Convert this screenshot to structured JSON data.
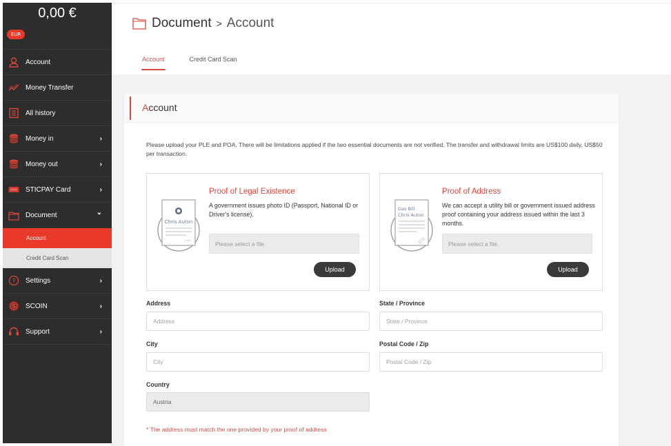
{
  "sidebar": {
    "balance": "0,00 €",
    "currency": "EUR",
    "items": [
      {
        "label": "Account",
        "icon": "user-icon",
        "has_chevron": false
      },
      {
        "label": "Money Transfer",
        "icon": "transfer-icon",
        "has_chevron": false
      },
      {
        "label": "All history",
        "icon": "history-icon",
        "has_chevron": false
      },
      {
        "label": "Money in",
        "icon": "money-in-icon",
        "has_chevron": true
      },
      {
        "label": "Money out",
        "icon": "money-out-icon",
        "has_chevron": true
      },
      {
        "label": "STICPAY Card",
        "icon": "card-icon",
        "has_chevron": true
      },
      {
        "label": "Document",
        "icon": "folder-icon",
        "has_chevron": true,
        "expanded": true
      },
      {
        "label": "Settings",
        "icon": "settings-icon",
        "has_chevron": true
      },
      {
        "label": "SCOIN",
        "icon": "scoin-icon",
        "has_chevron": true
      },
      {
        "label": "Support",
        "icon": "headset-icon",
        "has_chevron": true
      }
    ],
    "document_subitems": [
      {
        "label": "Account",
        "active": true
      },
      {
        "label": "Credit Card Scan",
        "active": false
      }
    ],
    "chevron_right": "›",
    "chevron_down": "⌄"
  },
  "header": {
    "breadcrumb": [
      "Document",
      "Account"
    ],
    "separator": ">",
    "tabs": [
      {
        "label": "Account",
        "active": true
      },
      {
        "label": "Credit Card Scan",
        "active": false
      }
    ]
  },
  "card": {
    "title_first": "A",
    "title_rest": "ccount",
    "intro": "Please upload your PLE and POA. There will be limitations applied if the two essential documents are not verified. The transfer and withdrawal limits are US$100 daily, US$50 per transaction.",
    "ple": {
      "title": "Proof of Legal Existence",
      "description": "A government issues photo ID (Passport, National ID or Driver's license).",
      "illustration_name": "Chris Auton",
      "file_placeholder": "Please select a file.",
      "upload_label": "Upload"
    },
    "poa": {
      "title": "Proof of Address",
      "description": "We can accept a utility bill or government issued address proof containing your address issued within the last 3 months.",
      "illustration_line1": "Gas Bill",
      "illustration_line2": "Chris Auton",
      "file_placeholder": "Please select a file.",
      "upload_label": "Upload"
    },
    "fields": {
      "address": {
        "label": "Address",
        "placeholder": "Address",
        "value": ""
      },
      "state": {
        "label": "State / Province",
        "placeholder": "State / Province",
        "value": ""
      },
      "city": {
        "label": "City",
        "placeholder": "City",
        "value": ""
      },
      "postal": {
        "label": "Postal Code / Zip",
        "placeholder": "Postal Code / Zip",
        "value": ""
      },
      "country": {
        "label": "Country",
        "value": "Austria"
      }
    },
    "note": "* The address must match the one provided by your proof of address"
  },
  "colors": {
    "accent": "#e8392a",
    "sidebar_bg": "#2d2d2d",
    "button_dark": "#3a3a3a"
  }
}
